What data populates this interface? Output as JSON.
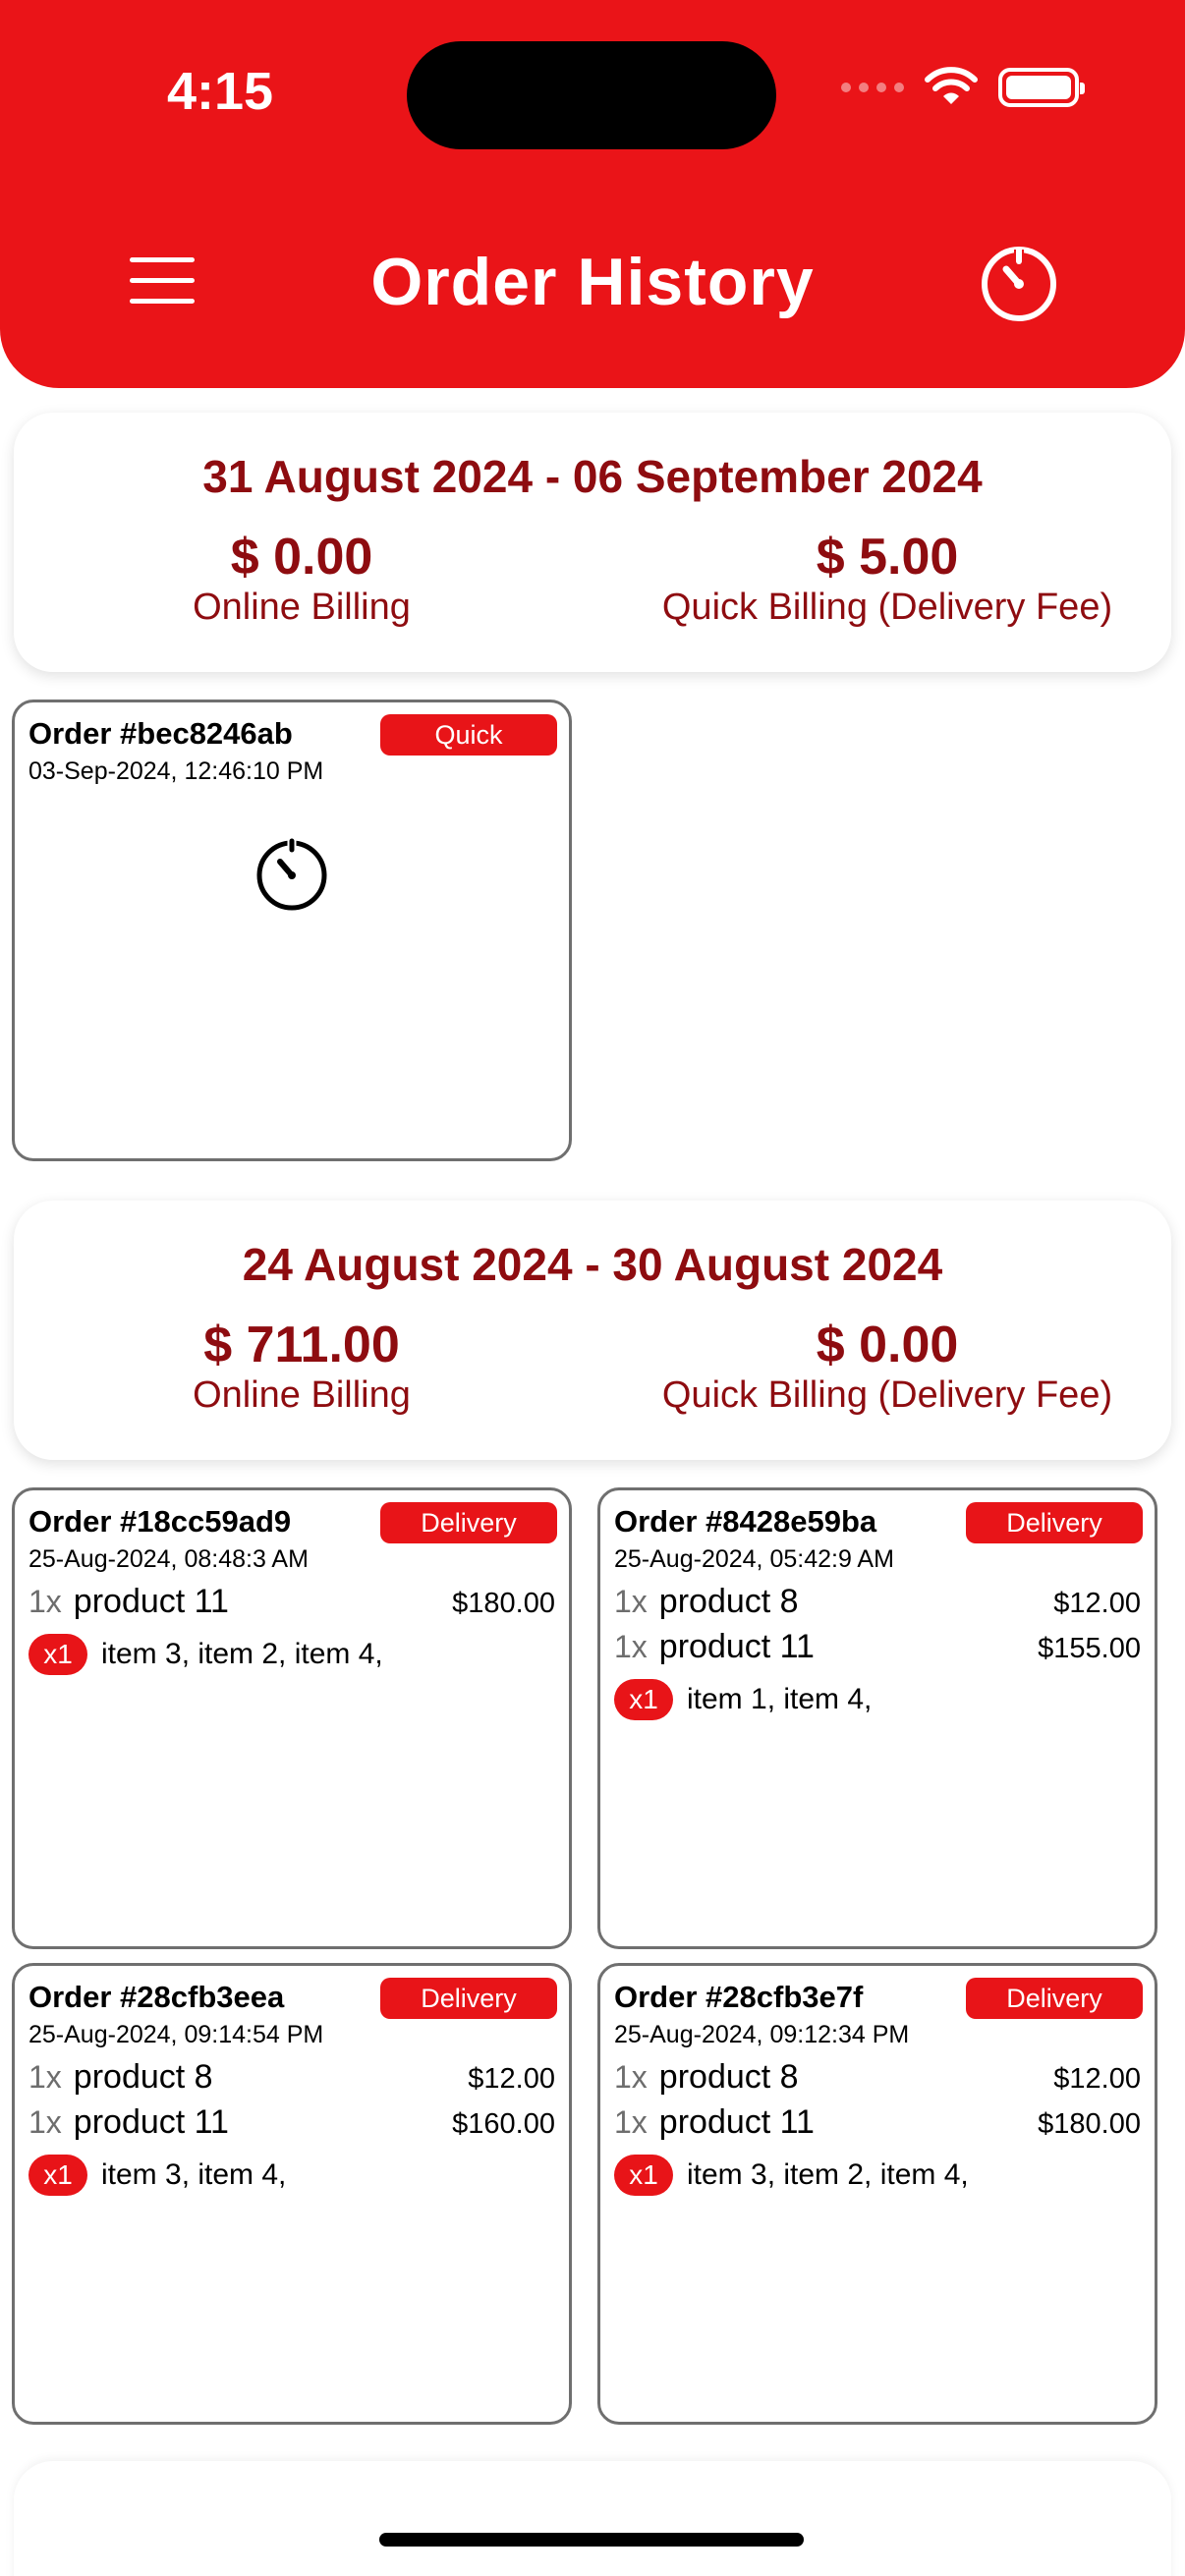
{
  "status_bar": {
    "time": "4:15"
  },
  "header": {
    "title": "Order History"
  },
  "icons": {
    "menu": "hamburger-menu-icon",
    "timer": "timer-icon",
    "wifi": "wifi-icon",
    "battery": "battery-icon"
  },
  "colors": {
    "brand": "#ea1418",
    "text_dark_red": "#8e0c10",
    "badge": "#e81418"
  },
  "weeks": [
    {
      "range": "31 August 2024 - 06 September 2024",
      "online_amount": "$ 0.00",
      "online_label": "Online Billing",
      "quick_amount": "$ 5.00",
      "quick_label": "Quick Billing (Delivery Fee)",
      "orders": [
        {
          "order_no": "Order #bec8246ab",
          "tag": "Quick",
          "date": "03-Sep-2024, 12:46:10 PM",
          "status_icon": "timer-icon"
        }
      ]
    },
    {
      "range": "24 August 2024 - 30 August 2024",
      "online_amount": "$ 711.00",
      "online_label": "Online Billing",
      "quick_amount": "$ 0.00",
      "quick_label": "Quick Billing (Delivery Fee)",
      "orders": [
        {
          "order_no": "Order #18cc59ad9",
          "tag": "Delivery",
          "date": "25-Aug-2024, 08:48:3 AM",
          "items": [
            {
              "qty": "1x",
              "name": "product 11",
              "price": "$180.00"
            }
          ],
          "addon_badge": "x1",
          "addons": "item 3, item 2, item 4,"
        },
        {
          "order_no": "Order #8428e59ba",
          "tag": "Delivery",
          "date": "25-Aug-2024, 05:42:9 AM",
          "items": [
            {
              "qty": "1x",
              "name": "product 8",
              "price": "$12.00"
            },
            {
              "qty": "1x",
              "name": "product 11",
              "price": "$155.00"
            }
          ],
          "addon_badge": "x1",
          "addons": "item 1, item 4,"
        },
        {
          "order_no": "Order #28cfb3eea",
          "tag": "Delivery",
          "date": "25-Aug-2024, 09:14:54 PM",
          "items": [
            {
              "qty": "1x",
              "name": "product 8",
              "price": "$12.00"
            },
            {
              "qty": "1x",
              "name": "product 11",
              "price": "$160.00"
            }
          ],
          "addon_badge": "x1",
          "addons": "item 3, item 4,"
        },
        {
          "order_no": "Order #28cfb3e7f",
          "tag": "Delivery",
          "date": "25-Aug-2024, 09:12:34 PM",
          "items": [
            {
              "qty": "1x",
              "name": "product 8",
              "price": "$12.00"
            },
            {
              "qty": "1x",
              "name": "product 11",
              "price": "$180.00"
            }
          ],
          "addon_badge": "x1",
          "addons": "item 3, item 2, item 4,"
        }
      ]
    }
  ]
}
